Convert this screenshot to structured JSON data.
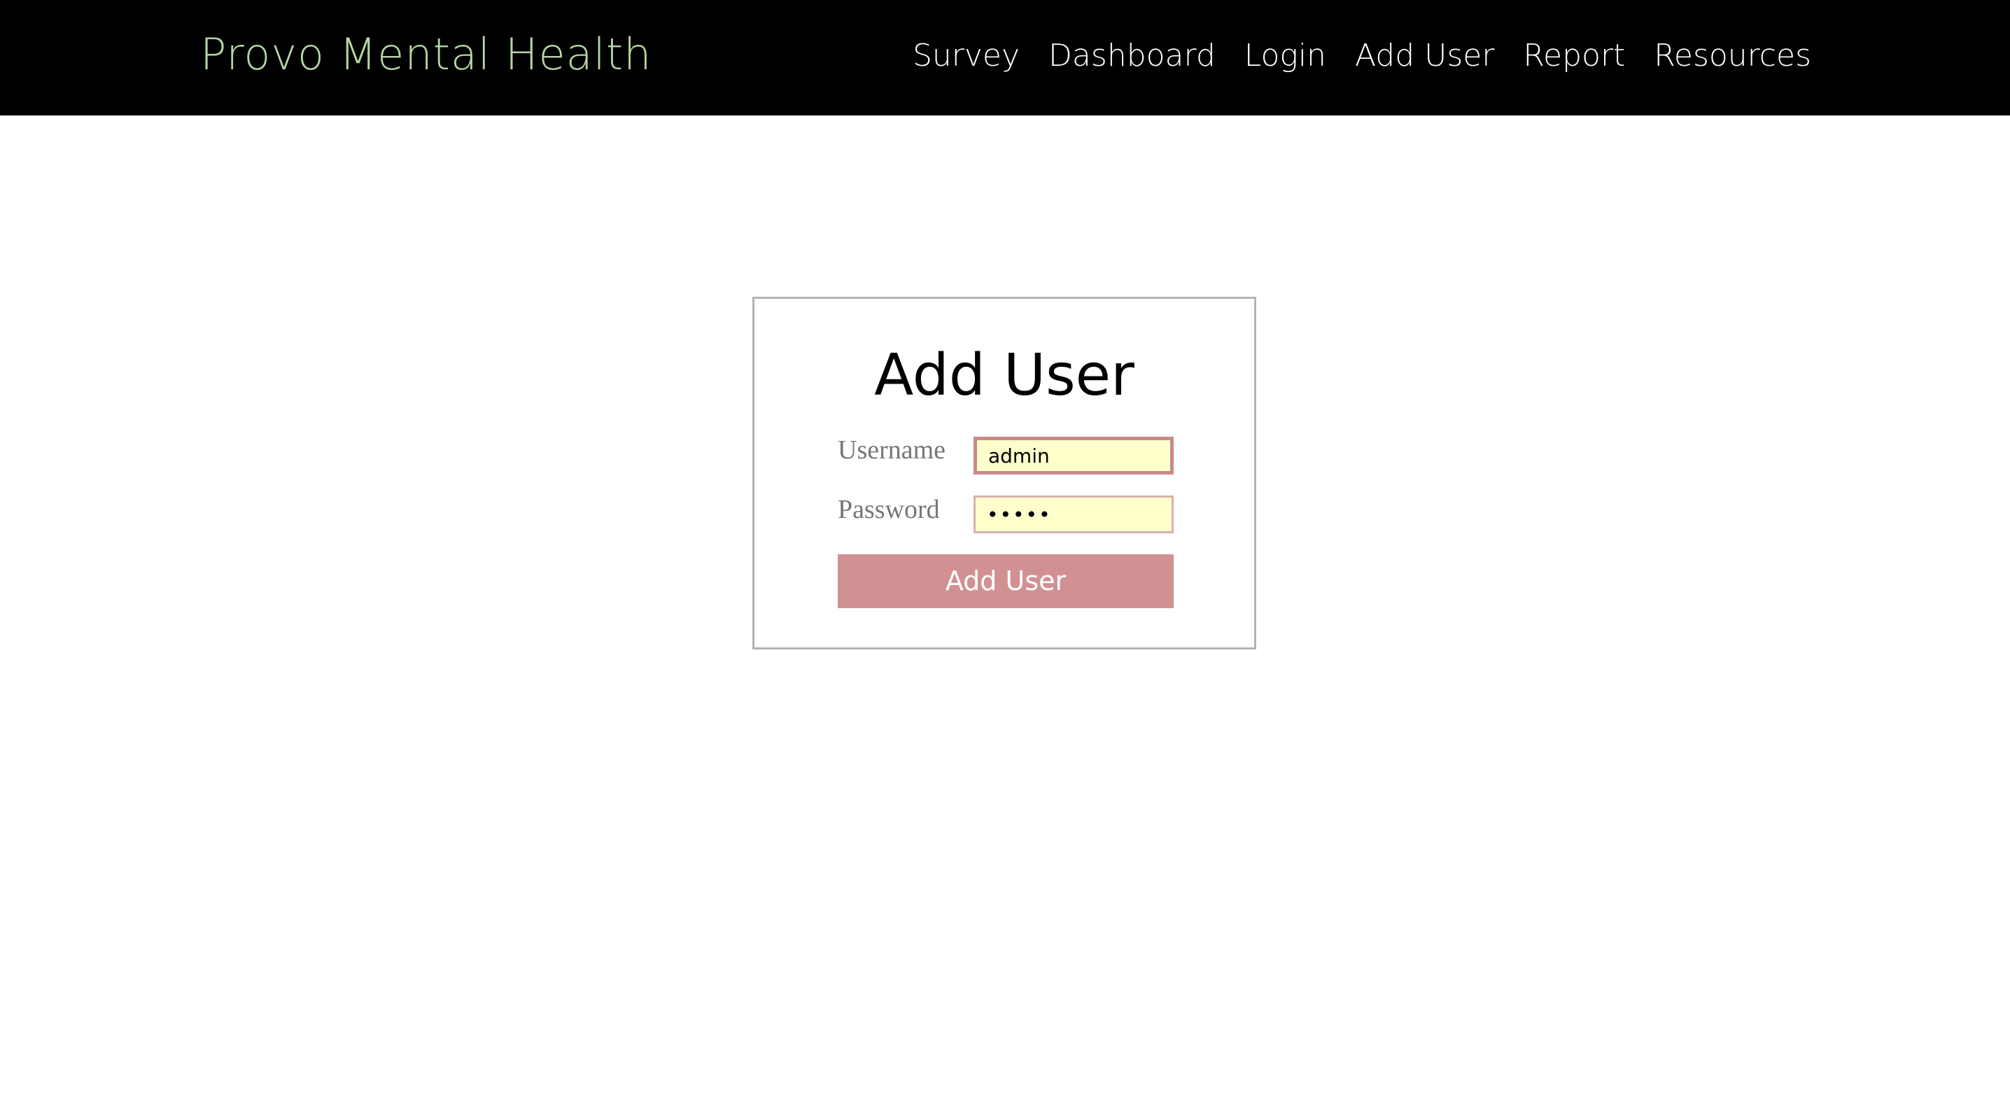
{
  "navbar": {
    "brand": "Provo Mental Health",
    "brand_color": "#b5d6a2",
    "links": [
      {
        "label": "Survey"
      },
      {
        "label": "Dashboard"
      },
      {
        "label": "Login"
      },
      {
        "label": "Add User"
      },
      {
        "label": "Report"
      },
      {
        "label": "Resources"
      }
    ]
  },
  "form": {
    "title": "Add User",
    "username_label": "Username",
    "username_value": "admin",
    "password_label": "Password",
    "password_value": "•••••",
    "submit_label": "Add User",
    "accent_color": "#d19193",
    "input_background": "#ffffcc"
  }
}
